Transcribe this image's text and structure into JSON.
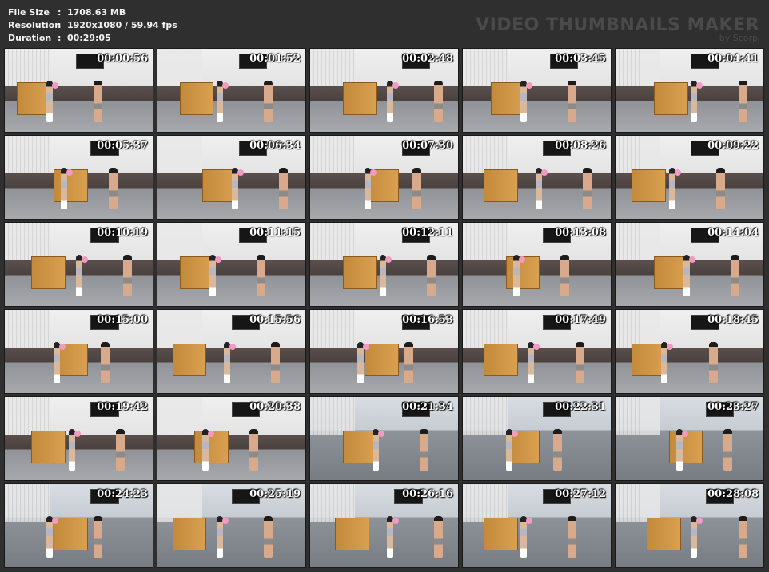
{
  "meta": {
    "file_size": {
      "key": "File Size",
      "sep": ":",
      "value": "1708.63 MB"
    },
    "resolution": {
      "key": "Resolution",
      "sep": ":",
      "value": "1920x1080 / 59.94 fps"
    },
    "duration": {
      "key": "Duration",
      "sep": ":",
      "value": "00:29:05"
    }
  },
  "watermark": {
    "title": "VIDEO THUMBNAILS MAKER",
    "subtitle": "by Scorp"
  },
  "thumbnails": [
    "00:00:56",
    "00:01:52",
    "00:02:48",
    "00:03:45",
    "00:04:41",
    "00:05:37",
    "00:06:34",
    "00:07:30",
    "00:08:26",
    "00:09:22",
    "00:10:19",
    "00:11:15",
    "00:12:11",
    "00:13:08",
    "00:14:04",
    "00:15:00",
    "00:15:56",
    "00:16:53",
    "00:17:49",
    "00:18:45",
    "00:19:42",
    "00:20:38",
    "00:21:34",
    "00:22:31",
    "00:23:27",
    "00:24:23",
    "00:25:19",
    "00:26:16",
    "00:27:12",
    "00:28:08"
  ]
}
